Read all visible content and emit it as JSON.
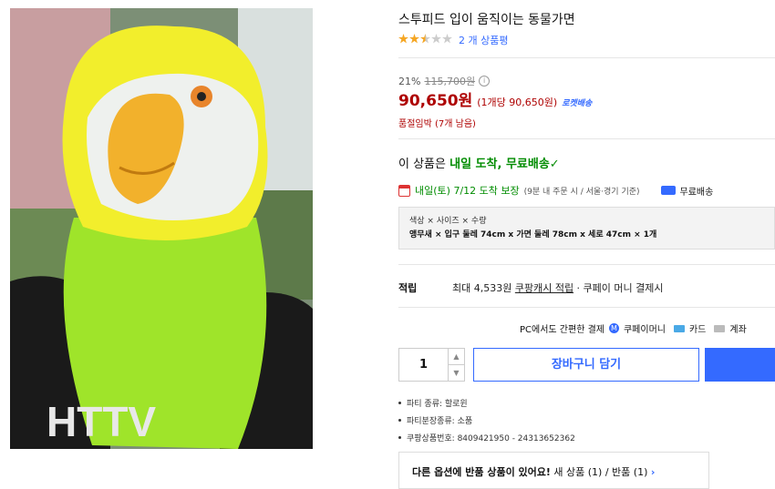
{
  "product": {
    "title": "스투피드 입이 움직이는 동물가면",
    "rating_stars": 2.5,
    "rating_count": "2 개 상품평",
    "discount_rate": "21%",
    "original_price": "115,700원",
    "price": "90,650원",
    "unit_price": "(1개당 90,650원)",
    "rocket_badge": "로켓배송",
    "stock_notice": "품절임박 (7개 남음)"
  },
  "delivery": {
    "headline_prefix": "이 상품은 ",
    "headline_highlight": "내일 도착, 무료배송",
    "headline_check": "✓",
    "date_text": "내일(토) 7/12 도착 보장",
    "date_note": "(9분 내 주문 시 / 서울·경기 기준)",
    "free_shipping": "무료배송"
  },
  "options": {
    "label": "색상 × 사이즈 × 수량",
    "value": "앵무새 × 입구 둘레 74cm x 가면 둘레 78cm x 세로 47cm × 1개"
  },
  "earn": {
    "label": "적립",
    "prefix": "최대 4,533원 ",
    "link": "쿠팡캐시 적립",
    "suffix": " · 쿠페이 머니 결제시"
  },
  "payment": {
    "label": "PC에서도 간편한 결제",
    "coupay": "쿠페이머니",
    "card": "카드",
    "bank": "계좌"
  },
  "purchase": {
    "quantity": "1",
    "cart_label": "장바구니 담기"
  },
  "details": [
    "파티 종류: 할로윈",
    "파티분장종류: 소품",
    "쿠팡상품번호: 8409421950 - 24313652362"
  ],
  "returns": {
    "bold": "다른 옵션에 반품 상품이 있어요!",
    "text": " 새 상품 (1) / 반품 (1)",
    "chevron": "›"
  },
  "colors": {
    "accent_blue": "#346aff",
    "price_red": "#ae0000",
    "delivery_green": "#008c00"
  }
}
